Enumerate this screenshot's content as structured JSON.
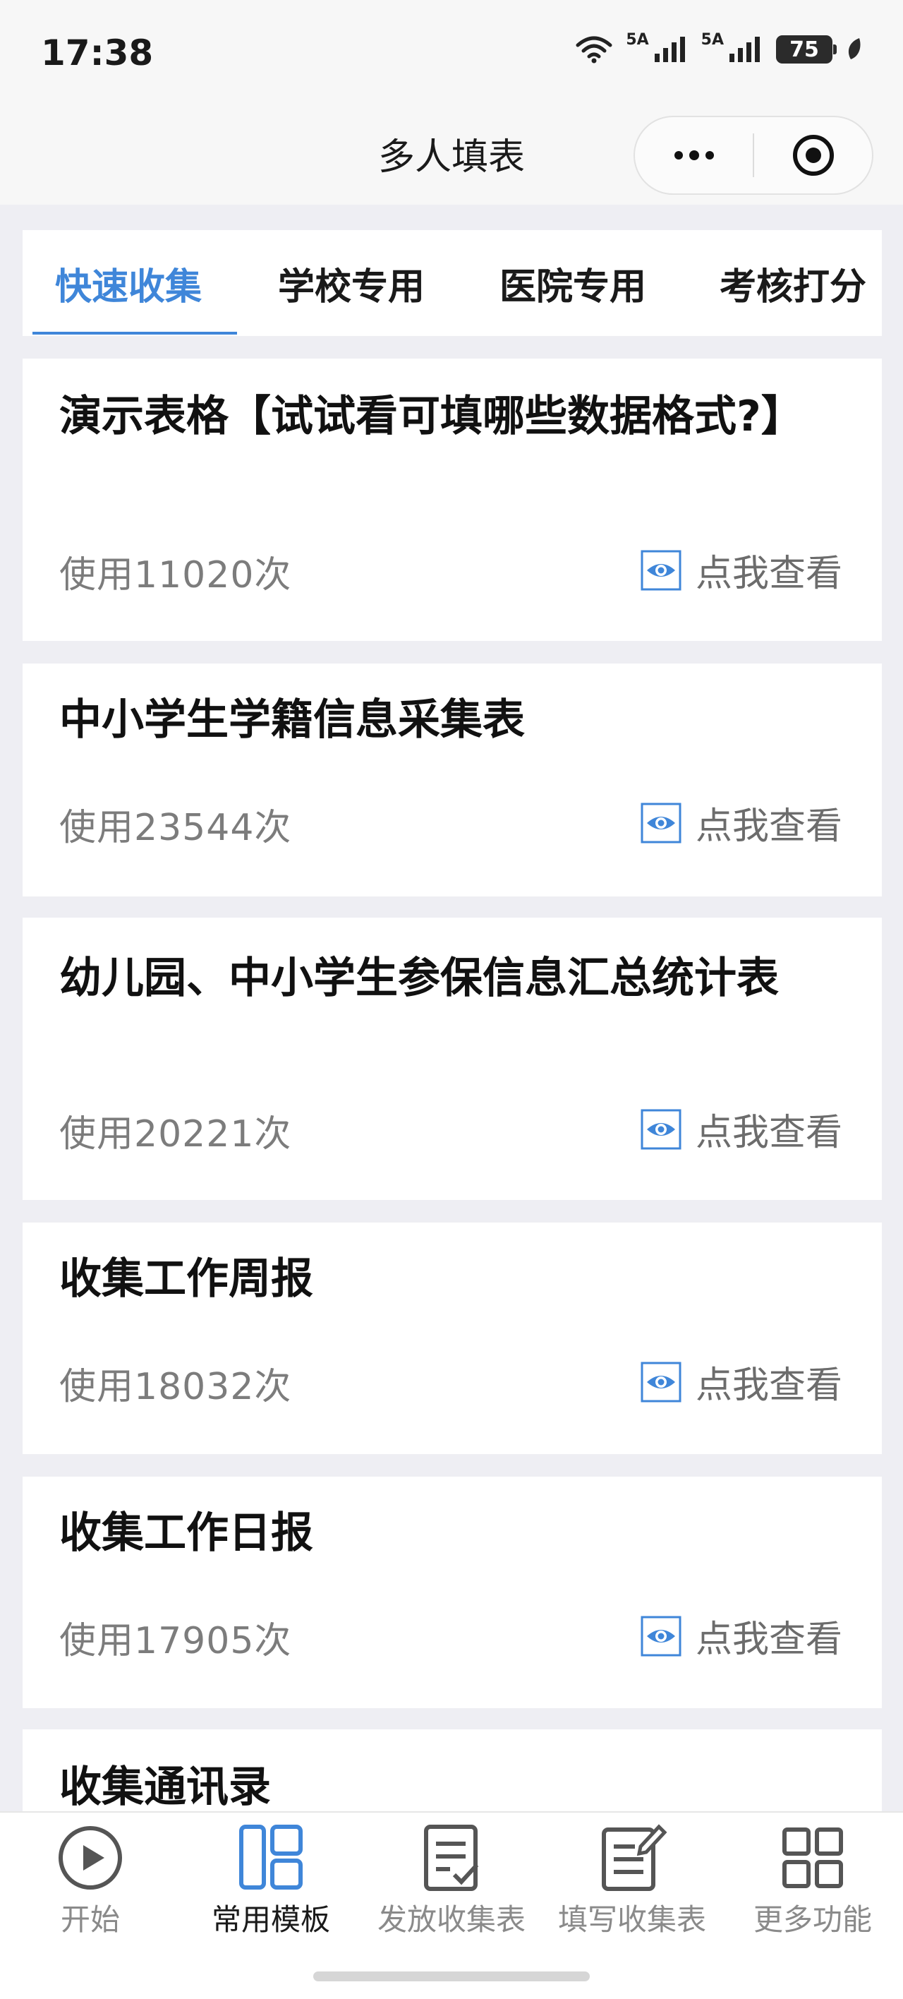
{
  "status_bar": {
    "time": "17:38",
    "network_1": "5A",
    "network_2": "5A",
    "battery": "75"
  },
  "header": {
    "title": "多人填表",
    "more_icon": "more-dots-icon",
    "close_icon": "target-circle-icon"
  },
  "tabs": [
    {
      "label": "快速收集",
      "active": true
    },
    {
      "label": "学校专用",
      "active": false
    },
    {
      "label": "医院专用",
      "active": false
    },
    {
      "label": "考核打分",
      "active": false
    }
  ],
  "cards": [
    {
      "title": "演示表格【试试看可填哪些数据格式?】",
      "usage": "使用11020次",
      "view_label": "点我查看"
    },
    {
      "title": "中小学生学籍信息采集表",
      "usage": "使用23544次",
      "view_label": "点我查看"
    },
    {
      "title": "幼儿园、中小学生参保信息汇总统计表",
      "usage": "使用20221次",
      "view_label": "点我查看"
    },
    {
      "title": "收集工作周报",
      "usage": "使用18032次",
      "view_label": "点我查看"
    },
    {
      "title": "收集工作日报",
      "usage": "使用17905次",
      "view_label": "点我查看"
    },
    {
      "title": "收集通讯录",
      "usage": "",
      "view_label": ""
    }
  ],
  "bottom_nav": [
    {
      "label": "开始",
      "icon": "play-circle-icon",
      "active": false
    },
    {
      "label": "常用模板",
      "icon": "template-grid-icon",
      "active": true
    },
    {
      "label": "发放收集表",
      "icon": "document-check-icon",
      "active": false
    },
    {
      "label": "填写收集表",
      "icon": "document-edit-icon",
      "active": false
    },
    {
      "label": "更多功能",
      "icon": "four-squares-icon",
      "active": false
    }
  ],
  "colors": {
    "accent": "#3f86d9",
    "page_background": "#eeeef3",
    "muted_text": "#7c7c7c"
  }
}
